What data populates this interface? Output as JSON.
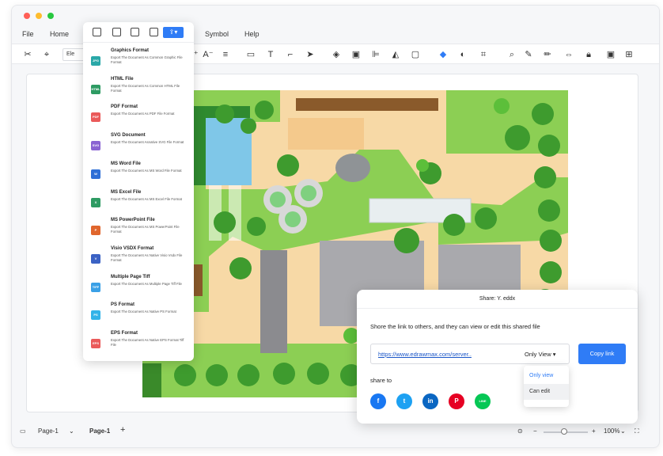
{
  "window": {
    "traffic_lights": [
      "#ff5f57",
      "#febc2e",
      "#28c840"
    ]
  },
  "menu": {
    "file": "File",
    "home": "Home",
    "view_tail": "w",
    "symbol": "Symbol",
    "help": "Help"
  },
  "toolbar": {
    "font_value": "Ele",
    "zoom_in_label": "A⁺",
    "zoom_out_label": "A⁻"
  },
  "export_menu": {
    "accent": "#2f7cf6",
    "items": [
      {
        "badge": "JPG",
        "color": "#2aa8a8",
        "title": "Graphics Format",
        "desc": "Export The Document As Common Graphic File Format"
      },
      {
        "badge": "HTML",
        "color": "#2e9b63",
        "title": "HTML File",
        "desc": "Export The Document As Common HTML File Format"
      },
      {
        "badge": "PDF",
        "color": "#ea5a5a",
        "title": "PDF Format",
        "desc": "Export The Document As PDF File Format"
      },
      {
        "badge": "SVG",
        "color": "#8a63d2",
        "title": "SVG Document",
        "desc": "Export The Document Asnative SVG File Format"
      },
      {
        "badge": "W",
        "color": "#2f6fd6",
        "title": "MS Word File",
        "desc": "Export The Document As MS Word File Format"
      },
      {
        "badge": "X",
        "color": "#2e9b63",
        "title": "MS Excel File",
        "desc": "Export The Document As MS Excel File Format"
      },
      {
        "badge": "P",
        "color": "#e0662d",
        "title": "MS PowerPoint File",
        "desc": "Export The Document As MS PowerPoint File Format"
      },
      {
        "badge": "V",
        "color": "#3b62c4",
        "title": "Visio VSDX Format",
        "desc": "Export The Document As Native Visio Vsdx File Format"
      },
      {
        "badge": "TIFF",
        "color": "#3aa0e6",
        "title": "Multiple Page Tiff",
        "desc": "Export The Document As Multiple Page Tiff File"
      },
      {
        "badge": "PS",
        "color": "#33b3e8",
        "title": "PS Format",
        "desc": "Export The Document As Native PS Format"
      },
      {
        "badge": "EPS",
        "color": "#ea5a5a",
        "title": "EPS Format",
        "desc": "Export The Document As Native EPS Format Tiff File"
      }
    ]
  },
  "share_dialog": {
    "title": "Share: Y. eddx",
    "message": "Shore the link to others, and they can view or edit this shared file",
    "url": "https://www.edrawmax.com/server..",
    "permission": "Only View",
    "copy_button": "Copy link",
    "share_to": "share to",
    "socials": [
      {
        "icon": "facebook-icon",
        "glyph": "f",
        "color": "#1877f2"
      },
      {
        "icon": "twitter-icon",
        "glyph": "t",
        "color": "#1da1f2"
      },
      {
        "icon": "linkedin-icon",
        "glyph": "in",
        "color": "#0a66c2"
      },
      {
        "icon": "pinterest-icon",
        "glyph": "P",
        "color": "#e60023"
      },
      {
        "icon": "line-icon",
        "glyph": "LINE",
        "color": "#06c755"
      }
    ]
  },
  "permission_dropdown": {
    "options": [
      "Only view",
      "Can edit"
    ],
    "selected": "Only view"
  },
  "statusbar": {
    "page_selector": "Page-1",
    "active_page": "Page-1",
    "add": "+",
    "zoom": "100%"
  }
}
